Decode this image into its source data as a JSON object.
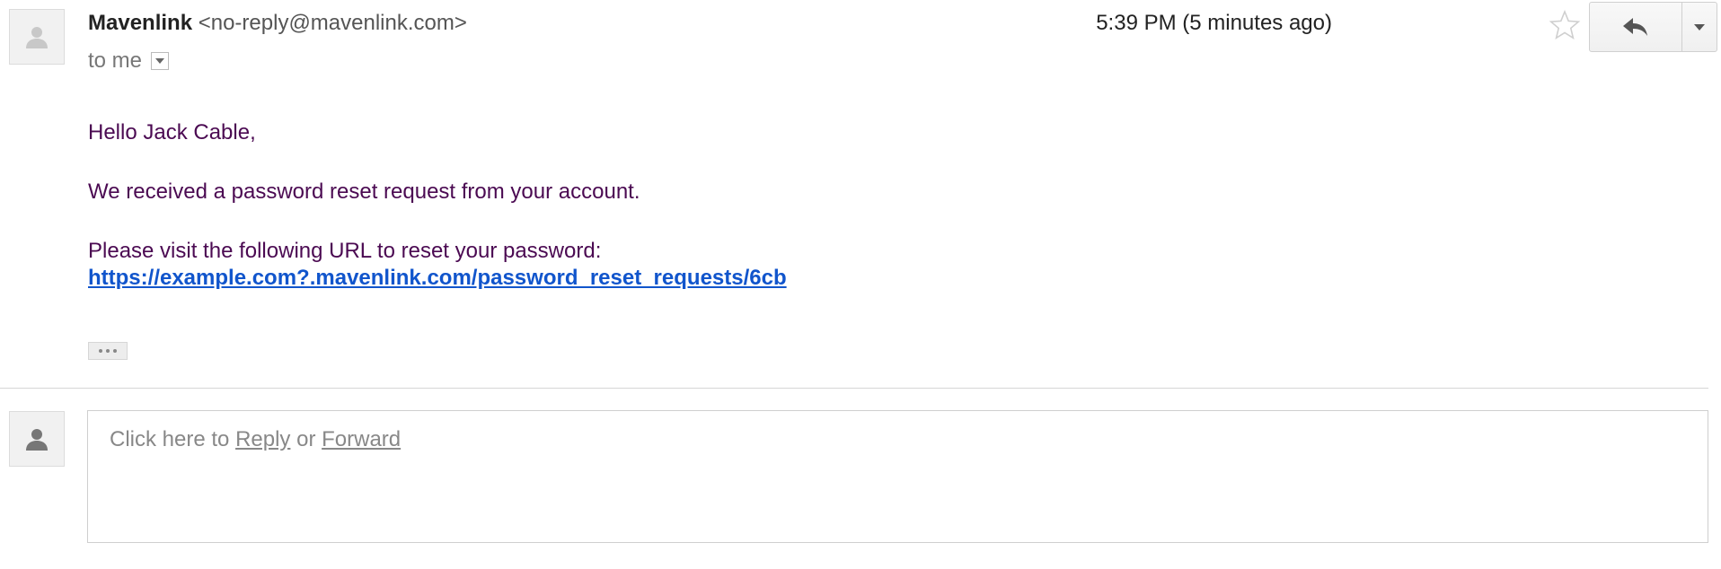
{
  "message": {
    "sender_name": "Mavenlink",
    "sender_email": "<no-reply@mavenlink.com>",
    "to_label": "to me",
    "timestamp": "5:39 PM (5 minutes ago)"
  },
  "body": {
    "greeting": "Hello Jack Cable,",
    "line1": "We received a password reset request from your account.",
    "line2": "Please visit the following URL to reset your password:",
    "link": "https://example.com?.mavenlink.com/password_reset_requests/6cb"
  },
  "reply_area": {
    "prefix": "Click here to",
    "reply_label": "Reply",
    "or_label": "or",
    "forward_label": "Forward"
  },
  "colors": {
    "body_text": "#4b0a52",
    "link": "#1155cc"
  },
  "icons": {
    "avatar": "person-icon",
    "star": "star-icon",
    "reply": "reply-arrow-icon",
    "more": "caret-down-icon"
  }
}
